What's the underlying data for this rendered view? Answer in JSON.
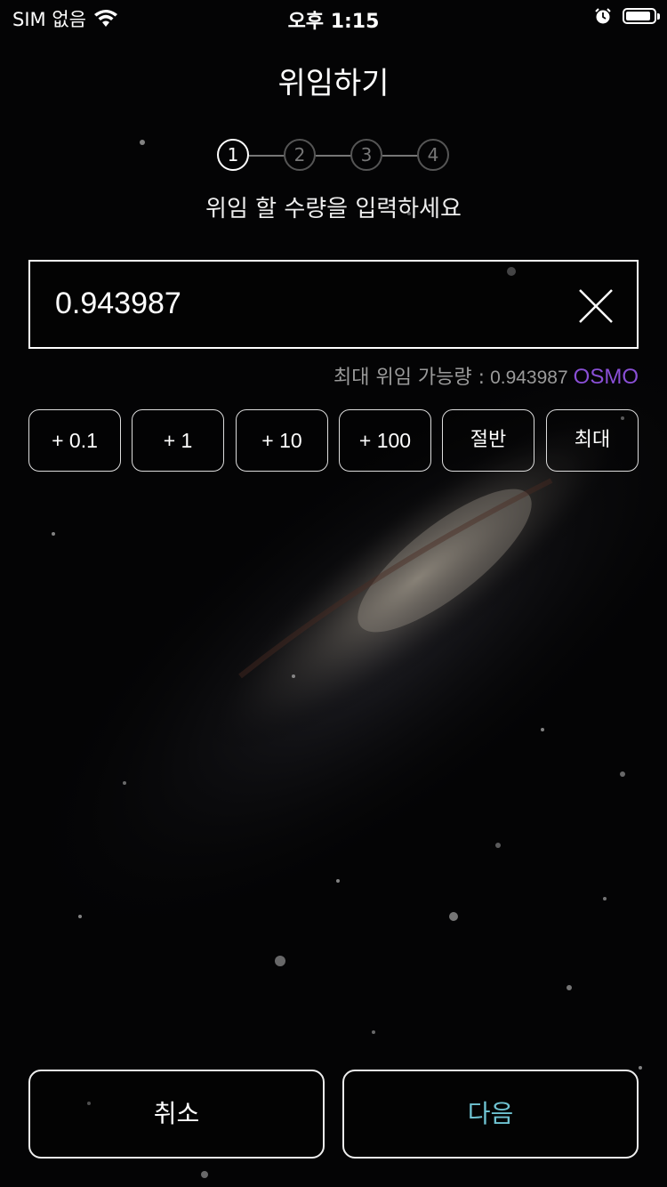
{
  "status_bar": {
    "carrier": "SIM 없음",
    "time": "오후 1:15",
    "icons": [
      "wifi-icon",
      "alarm-icon",
      "battery-icon"
    ],
    "battery_level": 0.9
  },
  "header": {
    "title": "위임하기"
  },
  "stepper": {
    "steps": [
      "1",
      "2",
      "3",
      "4"
    ],
    "current": 1
  },
  "subtitle": "위임 할 수량을 입력하세요",
  "amount_input": {
    "value": "0.943987",
    "clear_icon": "close-icon"
  },
  "max_info": {
    "label": "최대 위임 가능량 :",
    "amount": "0.943987",
    "unit": "OSMO"
  },
  "quick_buttons": [
    "+ 0.1",
    "+ 1",
    "+ 10",
    "+ 100",
    "절반",
    "최대"
  ],
  "footer": {
    "cancel_label": "취소",
    "next_label": "다음"
  },
  "colors": {
    "accent_purple": "#8a4fd6",
    "next_cyan": "#6fc3d2"
  }
}
